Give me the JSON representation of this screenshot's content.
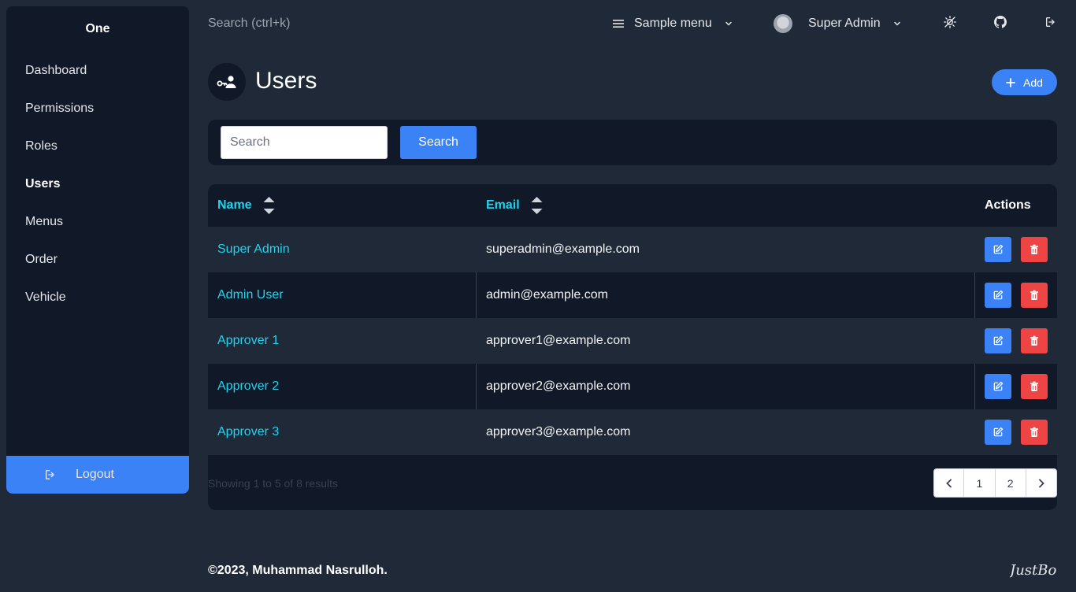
{
  "sidebar": {
    "brand": "One",
    "items": [
      {
        "label": "Dashboard"
      },
      {
        "label": "Permissions"
      },
      {
        "label": "Roles"
      },
      {
        "label": "Users"
      },
      {
        "label": "Menus"
      },
      {
        "label": "Order"
      },
      {
        "label": "Vehicle"
      }
    ],
    "active": "Users",
    "logout_label": "Logout"
  },
  "topbar": {
    "search_placeholder": "Search (ctrl+k)",
    "sample_menu_label": "Sample menu",
    "user_name": "Super Admin",
    "icons": [
      "theme-toggle-icon",
      "github-icon",
      "logout-icon"
    ]
  },
  "page": {
    "title": "Users",
    "add_label": "Add",
    "icon": "user-key-icon"
  },
  "search": {
    "placeholder": "Search",
    "button_label": "Search"
  },
  "table": {
    "columns": [
      "Name",
      "Email",
      "Actions"
    ],
    "rows": [
      {
        "name": "Super Admin",
        "email": "superadmin@example.com"
      },
      {
        "name": "Admin User",
        "email": "admin@example.com"
      },
      {
        "name": "Approver 1",
        "email": "approver1@example.com"
      },
      {
        "name": "Approver 2",
        "email": "approver2@example.com"
      },
      {
        "name": "Approver 3",
        "email": "approver3@example.com"
      }
    ],
    "results_text": "Showing 1 to 5 of 8 results",
    "pages": [
      "1",
      "2"
    ]
  },
  "footer": {
    "copyright": "©2023, Muhammad Nasrulloh.",
    "logo_text": "JustBoil"
  },
  "colors": {
    "background": "#1f2937",
    "panel": "#111827",
    "accent": "#3b82f6",
    "link": "#22d3ee",
    "danger": "#ef4444"
  }
}
